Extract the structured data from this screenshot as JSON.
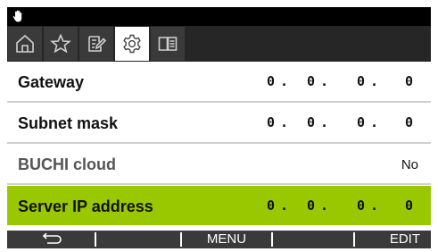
{
  "status_bar": {
    "icon": "hand-icon"
  },
  "tabs": [
    {
      "icon": "home-icon",
      "active": false
    },
    {
      "icon": "star-icon",
      "active": false
    },
    {
      "icon": "edit-icon",
      "active": false
    },
    {
      "icon": "gear-icon",
      "active": true
    },
    {
      "icon": "book-icon",
      "active": false
    }
  ],
  "rows": [
    {
      "label": "Gateway",
      "ip": [
        "0",
        "0",
        "0",
        "0"
      ],
      "sep": "."
    },
    {
      "label": "Subnet mask",
      "ip": [
        "0",
        "0",
        "0",
        "0"
      ],
      "sep": "."
    },
    {
      "label": "BUCHI cloud",
      "value": "No"
    },
    {
      "label": "Server IP address",
      "ip": [
        "0",
        "0",
        "0",
        "0"
      ],
      "sep": "."
    }
  ],
  "softkeys": {
    "back_icon": "back-arrow-icon",
    "menu": "MENU",
    "edit": "EDIT"
  },
  "colors": {
    "highlight": "#99c800",
    "tabbar": "#262626",
    "softkeys": "#3a3a3a"
  }
}
